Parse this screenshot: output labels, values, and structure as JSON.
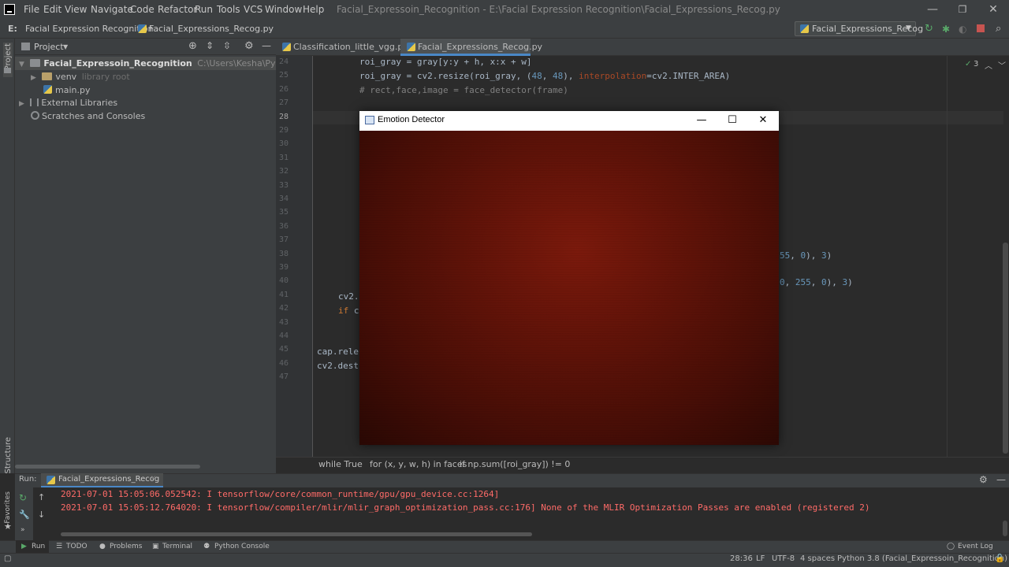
{
  "menu": [
    "File",
    "Edit",
    "View",
    "Navigate",
    "Code",
    "Refactor",
    "Run",
    "Tools",
    "VCS",
    "Window",
    "Help"
  ],
  "window_title": "Facial_Expressoin_Recognition - E:\\Facial Expression Recognition\\Facial_Expressions_Recog.py",
  "navbar": {
    "drive": "E:",
    "project": "Facial Expression Recognition",
    "file": "Facial_Expressions_Recog.py",
    "run_config": "Facial_Expressions_Recog"
  },
  "left_stripe": {
    "project": "Project",
    "structure": "Structure",
    "favorites": "Favorites"
  },
  "project_panel": {
    "title": "Project",
    "root": "Facial_Expressoin_Recognition",
    "root_path": "C:\\Users\\Kesha\\PycharmProjects\\F",
    "venv": "venv",
    "venv_hint": "library root",
    "main": "main.py",
    "external": "External Libraries",
    "scratches": "Scratches and Consoles"
  },
  "editor_tabs": [
    "Classification_little_vgg.py",
    "Facial_Expressions_Recog.py"
  ],
  "line_numbers": [
    "24",
    "25",
    "26",
    "27",
    "28",
    "29",
    "30",
    "31",
    "32",
    "33",
    "34",
    "35",
    "36",
    "37",
    "38",
    "39",
    "40",
    "41",
    "42",
    "43",
    "44",
    "45",
    "46",
    "47"
  ],
  "code": {
    "l24": "roi_gray = gray[y:y + h, x:x + w]",
    "l25_a": "roi_gray = cv2.resize(roi_gray, (",
    "l25_n1": "48",
    "l25_c": ", ",
    "l25_n2": "48",
    "l25_d": "), ",
    "l25_p": "interpolation",
    "l25_e": "=cv2.INTER_AREA)",
    "l26": "# rect,face,image = face_detector(frame)",
    "l38_a": "55",
    "l38_b": ", ",
    "l38_c": "0",
    "l38_d": "), ",
    "l38_e": "3",
    "l38_f": ")",
    "l40_a": "0",
    "l40_b": ", ",
    "l40_c": "255",
    "l40_d": ", ",
    "l40_e": "0",
    "l40_f": "), ",
    "l40_g": "3",
    "l40_h": ")",
    "l41": "cv2.",
    "l42_kw": "if",
    "l42_rest": " c",
    "l45": "cap.rele",
    "l46": "cv2.dest"
  },
  "inspection_count": "3",
  "breadcrumb": [
    "while True",
    "for (x, y, w, h) in faces",
    "if np.sum([roi_gray]) != 0"
  ],
  "emotion_window": {
    "title": "Emotion Detector",
    "minimize": "—",
    "maximize": "☐",
    "close": "✕"
  },
  "run_panel": {
    "label": "Run:",
    "tab": "Facial_Expressions_Recog",
    "lines": [
      "2021-07-01 15:05:06.052542: I tensorflow/core/common_runtime/gpu/gpu_device.cc:1264]",
      "2021-07-01 15:05:12.764020: I tensorflow/compiler/mlir/mlir_graph_optimization_pass.cc:176] None of the MLIR Optimization Passes are enabled (registered 2)"
    ]
  },
  "bottom_tabs": [
    "Run",
    "TODO",
    "Problems",
    "Terminal",
    "Python Console"
  ],
  "event_log": "Event Log",
  "status": {
    "position": "28:36",
    "line_sep": "LF",
    "encoding": "UTF-8",
    "indent": "4 spaces",
    "interpreter": "Python 3.8 (Facial_Expressoin_Recognition)"
  },
  "colors": {
    "accent": "#4a88c7",
    "error_text": "#ff6b68",
    "run_green": "#59a869",
    "stop_red": "#c75450"
  }
}
